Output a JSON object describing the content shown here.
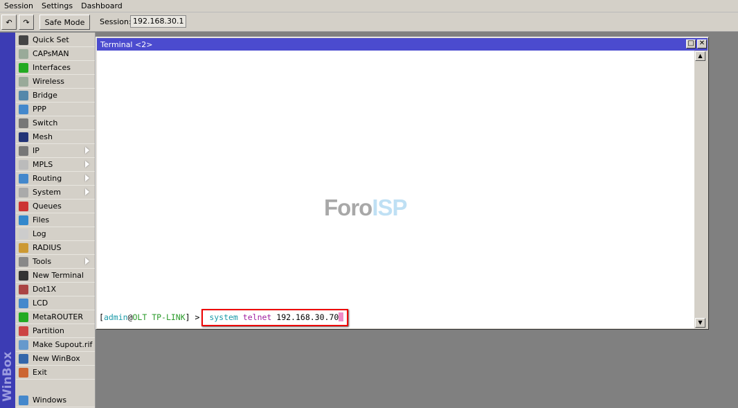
{
  "menu": [
    "Session",
    "Settings",
    "Dashboard"
  ],
  "toolbar": {
    "undo": "↶",
    "redo": "↷",
    "safe_mode": "Safe Mode",
    "session_label": "Session:",
    "session_value": "192.168.30.1"
  },
  "sidebar": {
    "brand": "WinBox",
    "items": [
      {
        "label": "Quick Set",
        "icon": "wand-icon",
        "color": "#444"
      },
      {
        "label": "CAPsMAN",
        "icon": "antenna-icon",
        "color": "#9a9"
      },
      {
        "label": "Interfaces",
        "icon": "interfaces-icon",
        "color": "#2a2"
      },
      {
        "label": "Wireless",
        "icon": "wireless-icon",
        "color": "#9a9"
      },
      {
        "label": "Bridge",
        "icon": "bridge-icon",
        "color": "#58a"
      },
      {
        "label": "PPP",
        "icon": "ppp-icon",
        "color": "#48c"
      },
      {
        "label": "Switch",
        "icon": "switch-icon",
        "color": "#777"
      },
      {
        "label": "Mesh",
        "icon": "mesh-icon",
        "color": "#237"
      },
      {
        "label": "IP",
        "icon": "ip-icon",
        "color": "#777",
        "submenu": true
      },
      {
        "label": "MPLS",
        "icon": "mpls-icon",
        "color": "#bbb",
        "submenu": true
      },
      {
        "label": "Routing",
        "icon": "routing-icon",
        "color": "#48c",
        "submenu": true
      },
      {
        "label": "System",
        "icon": "system-icon",
        "color": "#aaa",
        "submenu": true
      },
      {
        "label": "Queues",
        "icon": "queues-icon",
        "color": "#c33"
      },
      {
        "label": "Files",
        "icon": "files-icon",
        "color": "#38c"
      },
      {
        "label": "Log",
        "icon": "log-icon",
        "color": "#ccc"
      },
      {
        "label": "RADIUS",
        "icon": "radius-icon",
        "color": "#c93"
      },
      {
        "label": "Tools",
        "icon": "tools-icon",
        "color": "#888",
        "submenu": true
      },
      {
        "label": "New Terminal",
        "icon": "terminal-icon",
        "color": "#333"
      },
      {
        "label": "Dot1X",
        "icon": "dot1x-icon",
        "color": "#a44"
      },
      {
        "label": "LCD",
        "icon": "lcd-icon",
        "color": "#48c"
      },
      {
        "label": "MetaROUTER",
        "icon": "metarouter-icon",
        "color": "#2a2"
      },
      {
        "label": "Partition",
        "icon": "partition-icon",
        "color": "#c44"
      },
      {
        "label": "Make Supout.rif",
        "icon": "supout-icon",
        "color": "#69c"
      },
      {
        "label": "New WinBox",
        "icon": "winbox-icon",
        "color": "#36a"
      },
      {
        "label": "Exit",
        "icon": "exit-icon",
        "color": "#c63"
      }
    ],
    "windows": {
      "label": "Windows",
      "icon": "windows-icon",
      "color": "#48c"
    }
  },
  "terminal": {
    "title": "Terminal <2>",
    "prompt_open": "[",
    "user": "admin",
    "at": "@",
    "host": "OLT TP-LINK",
    "prompt_close": "] > ",
    "cmd1": "system",
    "cmd2": "telnet",
    "arg": "192.168.30.70",
    "watermark_a": "Foro",
    "watermark_b": "ISP"
  },
  "colors": {
    "titlebar": "#4b4bcf",
    "cursor": "#f08cc8",
    "highlight": "#e00000"
  }
}
